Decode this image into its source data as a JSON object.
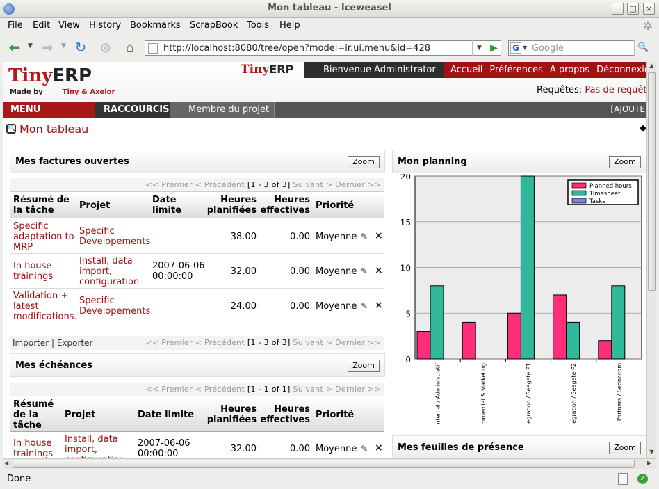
{
  "window": {
    "title": "Mon tableau - Iceweasel"
  },
  "menubar": {
    "items": [
      "File",
      "Edit",
      "View",
      "History",
      "Bookmarks",
      "ScrapBook",
      "Tools",
      "Help"
    ]
  },
  "navbar": {
    "url": "http://localhost:8080/tree/open?model=ir.ui.menu&id=428",
    "search_placeholder": "Google"
  },
  "status": {
    "text": "Done"
  },
  "header": {
    "logo_tiny": "Tiny",
    "logo_erp": "ERP",
    "logo_madeby": "Made by",
    "logo_makers": "Tiny & Axelor",
    "small_logo_tiny": "Tiny",
    "small_logo_erp": "ERP",
    "welcome": "Bienvenue Administrator",
    "nav": [
      "Accueil",
      "Préférences",
      "A propos",
      "Déconnexion"
    ],
    "requests_label": "Requêtes:",
    "requests_value": "Pas de requêt"
  },
  "tabs": {
    "main": "MENU PRINCIPAL",
    "shortcuts": "RACCOURCIS",
    "member": "Membre du projet",
    "add": "[AJOUTE"
  },
  "page": {
    "title": "Mon tableau"
  },
  "invoices": {
    "title": "Mes factures ouvertes",
    "zoom": "Zoom",
    "pager": {
      "first": "<< Premier",
      "prev": "< Précédent",
      "range": "[1 - 3 of 3]",
      "next": "Suivant >",
      "last": "Dernier >>"
    },
    "columns": [
      "Résumé de la tâche",
      "Projet",
      "Date limite",
      "Heures planifiées",
      "Heures effectives",
      "Priorité"
    ],
    "rows": [
      {
        "task": "Specific adaptation to MRP",
        "project": "Specific Developements",
        "date": "",
        "planned": "38.00",
        "effective": "0.00",
        "priority": "Moyenne"
      },
      {
        "task": "In house trainings",
        "project": "Install, data import, configuration",
        "date": "2007-06-06 00:00:00",
        "planned": "32.00",
        "effective": "0.00",
        "priority": "Moyenne"
      },
      {
        "task": "Validation + latest modifications.",
        "project": "Specific Developements",
        "date": "",
        "planned": "24.00",
        "effective": "0.00",
        "priority": "Moyenne"
      }
    ],
    "import": "Importer",
    "export": "Exporter"
  },
  "deadlines": {
    "title": "Mes échéances",
    "zoom": "Zoom",
    "pager": {
      "first": "<< Premier",
      "prev": "< Précédent",
      "range": "[1 - 1 of 1]",
      "next": "Suivant >",
      "last": "Dernier >>"
    },
    "columns": [
      "Résumé de la tâche",
      "Projet",
      "Date limite",
      "Heures planifiées",
      "Heures effectives",
      "Priorité"
    ],
    "rows": [
      {
        "task": "In house trainings",
        "project": "Install, data import, configuration",
        "date": "2007-06-06 00:00:00",
        "planned": "32.00",
        "effective": "0.00",
        "priority": "Moyenne"
      }
    ]
  },
  "planning": {
    "title": "Mon planning",
    "zoom": "Zoom"
  },
  "attendance": {
    "title": "Mes feuilles de présence",
    "zoom": "Zoom"
  },
  "colors": {
    "planned": "#ff2d7a",
    "timesheet": "#2fb99a",
    "tasks": "#8080e0",
    "brand_red": "#a01212"
  },
  "chart_data": {
    "type": "bar",
    "categories": [
      "nternal / Administratif",
      "mmercial & Marketing",
      "egration / Seagate P1",
      "egration / Seagate P2",
      "Partners / Sednacom"
    ],
    "series": [
      {
        "name": "Planned hours",
        "values": [
          3,
          4,
          5,
          7,
          2
        ]
      },
      {
        "name": "Timesheet",
        "values": [
          8,
          0,
          20,
          4,
          8
        ]
      },
      {
        "name": "Tasks",
        "values": [
          0,
          0,
          0,
          0,
          0
        ]
      }
    ],
    "ylim": [
      0,
      20
    ],
    "yticks": [
      0,
      5,
      10,
      15,
      20
    ],
    "grid": true,
    "legend": "top-right"
  }
}
